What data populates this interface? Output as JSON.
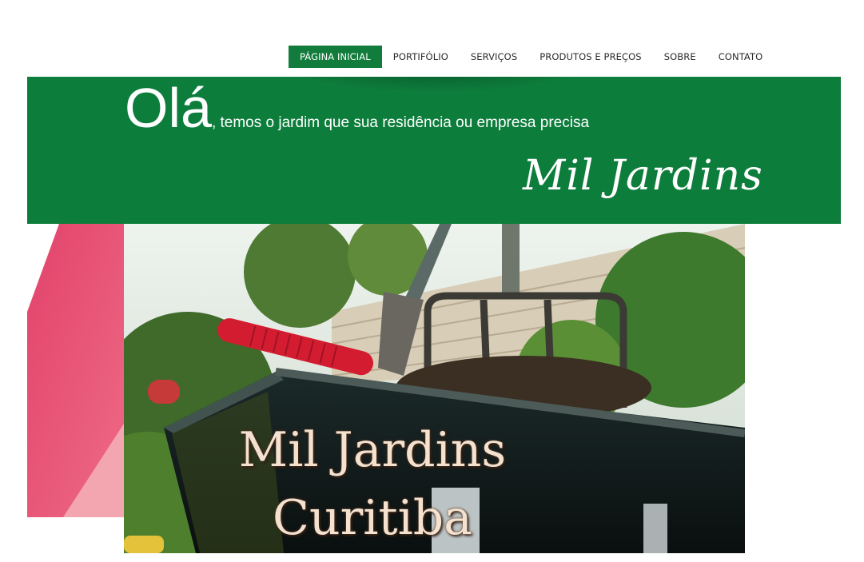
{
  "nav": {
    "items": [
      {
        "label": "PÁGINA INICIAL",
        "active": true
      },
      {
        "label": "PORTIFÓLIO",
        "active": false
      },
      {
        "label": "SERVIÇOS",
        "active": false
      },
      {
        "label": "PRODUTOS E PREÇOS",
        "active": false
      },
      {
        "label": "SOBRE",
        "active": false
      },
      {
        "label": "CONTATO",
        "active": false
      }
    ]
  },
  "hero": {
    "greeting_big": "Olá",
    "greeting_rest": ", temos o jardim que sua residência ou empresa precisa",
    "brand": "Mil Jardins",
    "background_color": "#0d7d3c"
  },
  "photo": {
    "title_line1": "Mil Jardins",
    "title_line2": "Curitiba"
  },
  "colors": {
    "nav_active": "#127c3c",
    "pink_accent": "#e8506e"
  }
}
